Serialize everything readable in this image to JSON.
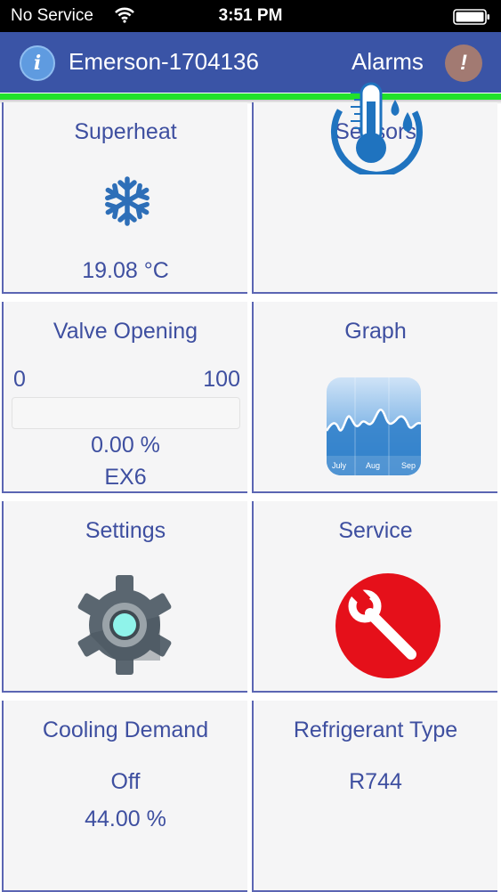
{
  "status_bar": {
    "carrier": "No Service",
    "time": "3:51 PM",
    "wifi_icon": "wifi-icon",
    "battery_icon": "battery-icon"
  },
  "header": {
    "device_name": "Emerson-1704136",
    "alarms_label": "Alarms",
    "info_icon_text": "i",
    "alarm_icon_text": "!",
    "bar_color": "#3a54a6",
    "accent_line_color": "#22e02a"
  },
  "tiles": {
    "superheat": {
      "title": "Superheat",
      "value": "19.08 °C",
      "icon": "snowflake-icon"
    },
    "sensors": {
      "title": "Sensors",
      "icon": "thermometer-drops-icon"
    },
    "valve_opening": {
      "title": "Valve Opening",
      "min": "0",
      "max": "100",
      "value": "0.00 %",
      "valve": "EX6",
      "level_percent": 0
    },
    "graph": {
      "title": "Graph",
      "icon": "graph-icon",
      "axis_labels": [
        "July",
        "Aug",
        "Sep"
      ]
    },
    "settings": {
      "title": "Settings",
      "icon": "gear-icon"
    },
    "service": {
      "title": "Service",
      "icon": "wrench-icon"
    },
    "cooling_demand": {
      "title": "Cooling Demand",
      "state": "Off",
      "value": "44.00 %"
    },
    "refrigerant_type": {
      "title": "Refrigerant Type",
      "value": "R744"
    }
  },
  "colors": {
    "text": "#3e4fa0",
    "tile_border": "#5b65b3",
    "tile_bg": "#f5f5f6",
    "service_red": "#e5101a",
    "icon_blue": "#2e6fb8"
  }
}
